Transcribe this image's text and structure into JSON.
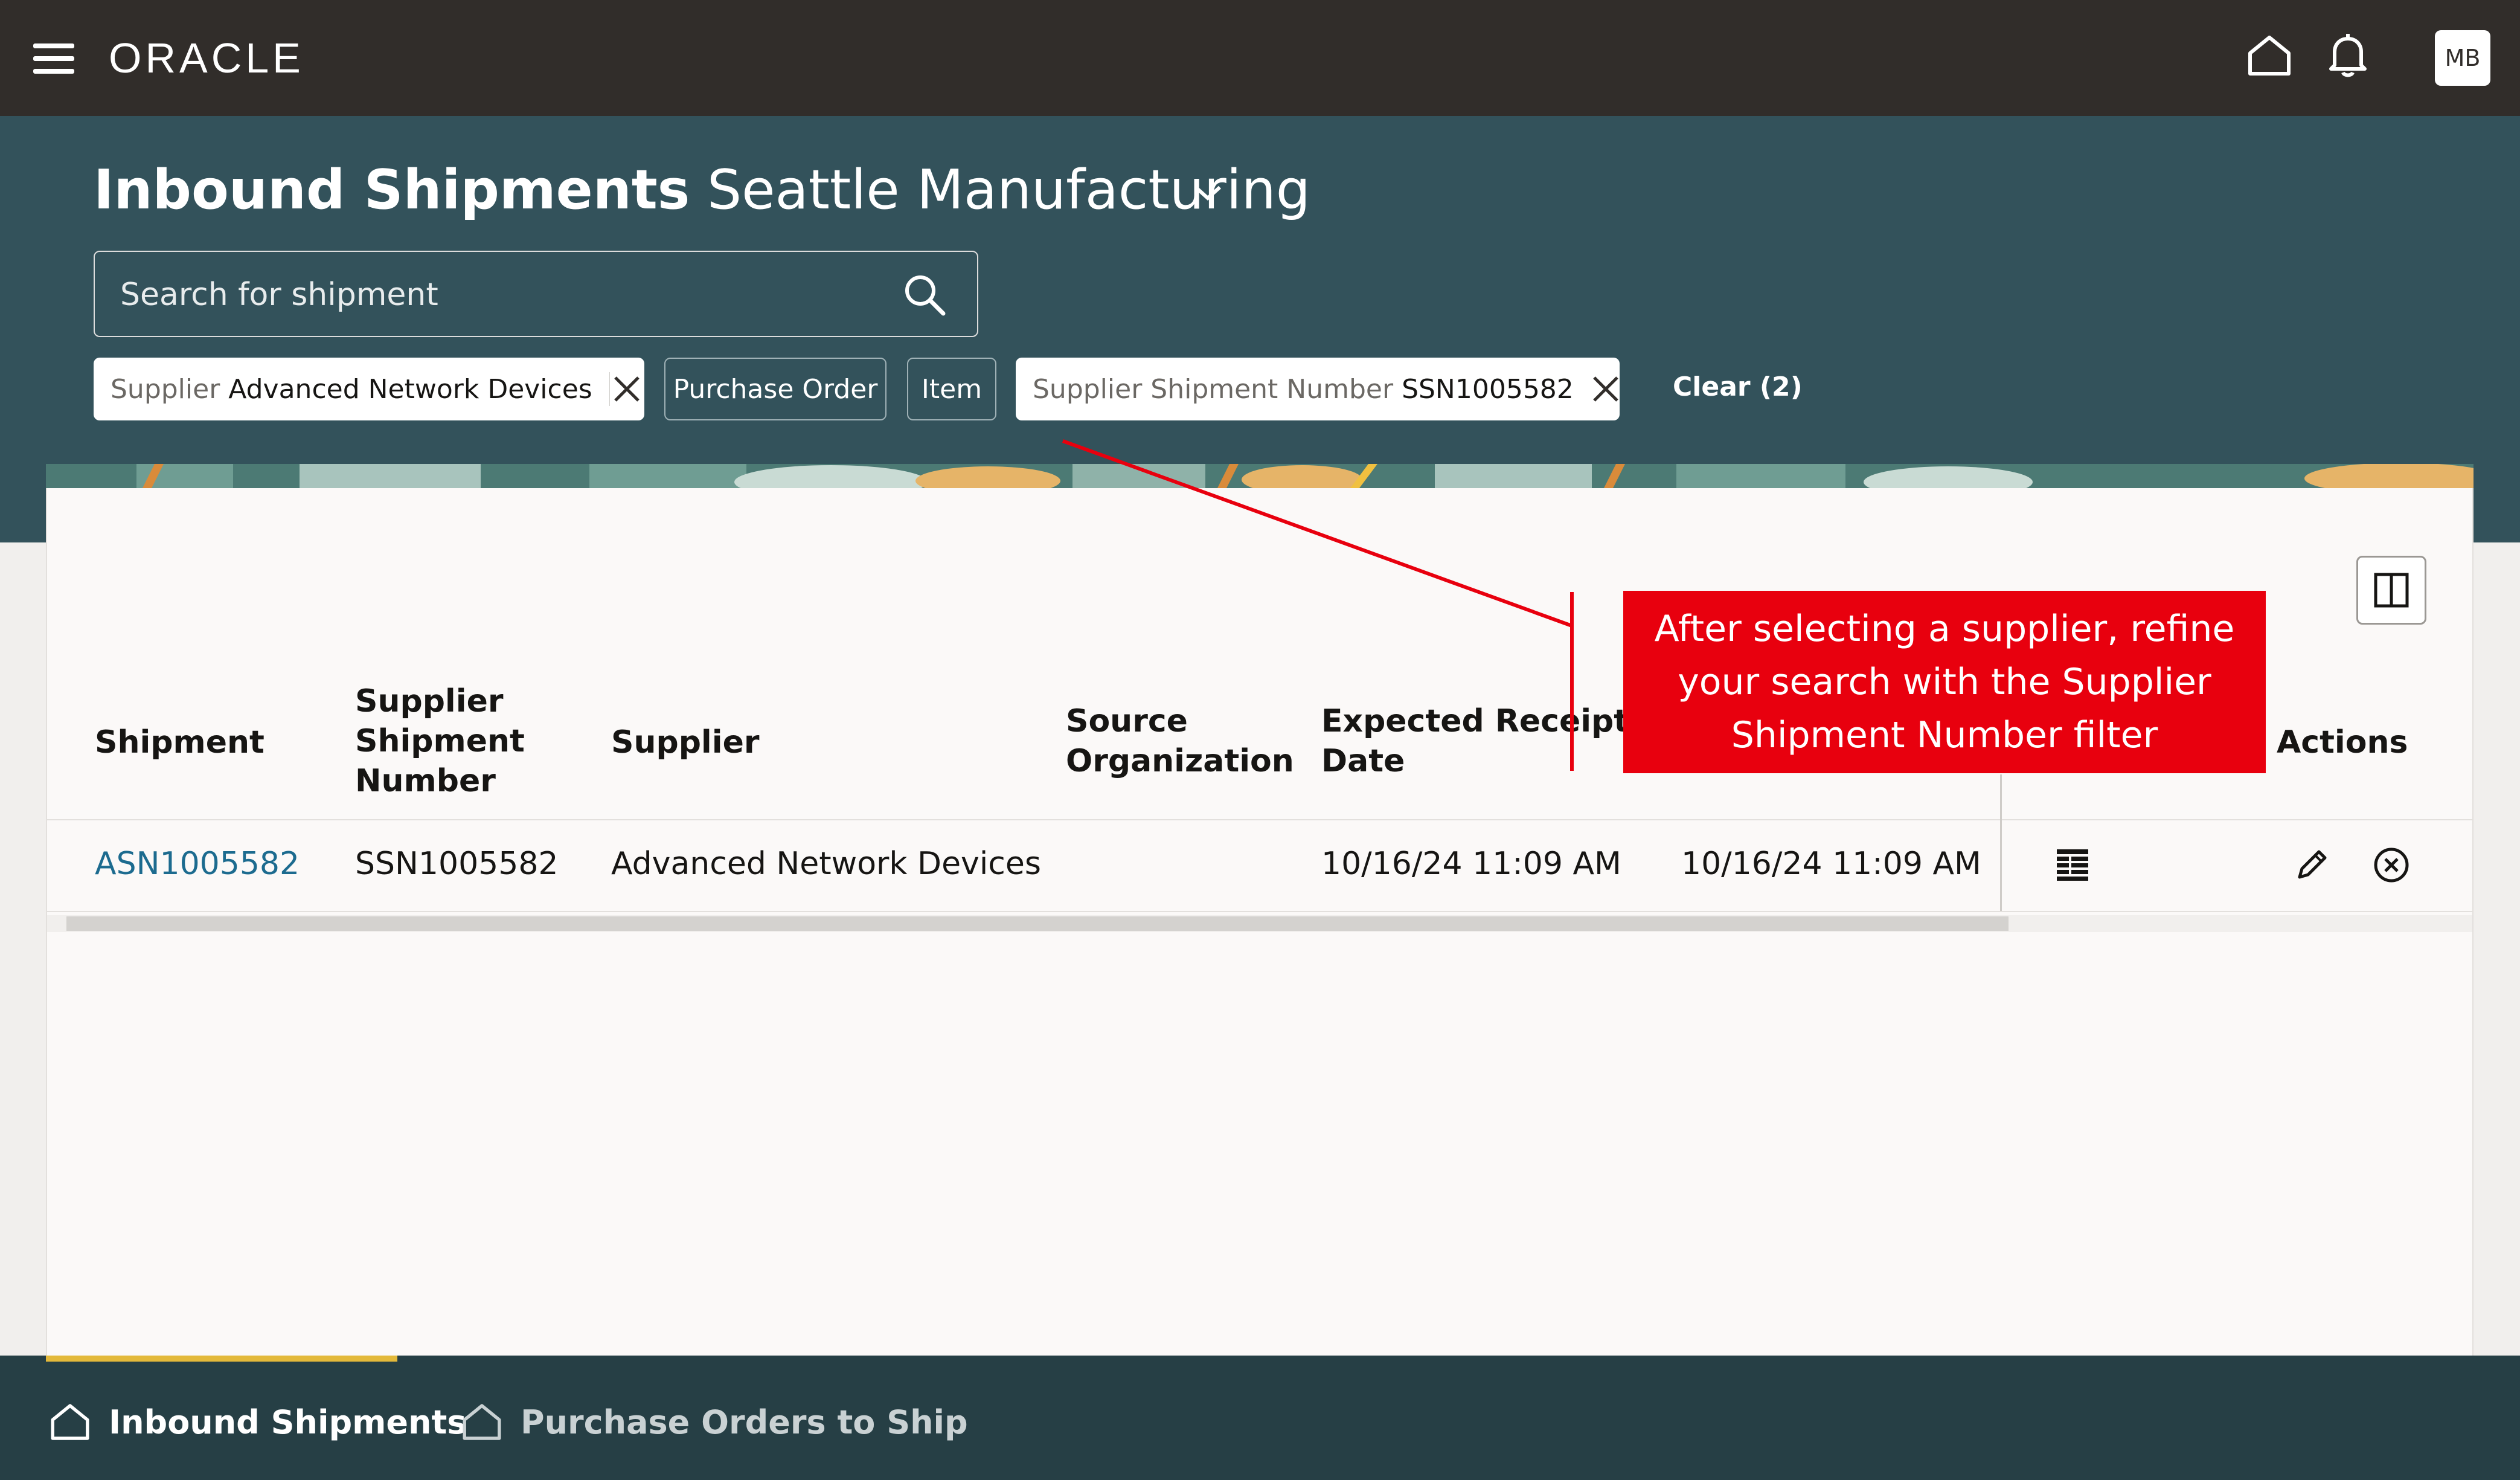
{
  "app": {
    "brand": "ORACLE",
    "user_initials": "MB"
  },
  "header": {
    "title": "Inbound Shipments",
    "organization": "Seattle Manufacturing"
  },
  "search": {
    "placeholder": "Search for shipment"
  },
  "filters": {
    "supplier": {
      "key": "Supplier",
      "value": "Advanced Network Devices"
    },
    "purchase_order": {
      "label": "Purchase Order"
    },
    "item": {
      "label": "Item"
    },
    "supplier_shipment_number": {
      "key": "Supplier Shipment Number",
      "value": "SSN1005582"
    },
    "clear": "Clear (2)"
  },
  "table": {
    "columns": {
      "shipment": "Shipment",
      "supplier_shipment_number": [
        "Supplier",
        "Shipment",
        "Number"
      ],
      "supplier": "Supplier",
      "source_organization": [
        "Source",
        "Organization"
      ],
      "expected_receipt_date": [
        "Expected Receipt",
        "Date"
      ],
      "actions": "Actions"
    },
    "rows": [
      {
        "shipment": "ASN1005582",
        "supplier_shipment_number": "SSN1005582",
        "supplier": "Advanced Network Devices",
        "source_organization": "",
        "expected_receipt_date": "10/16/24 11:09 AM",
        "shipped_date": "10/16/24 11:09 AM"
      }
    ]
  },
  "callout": {
    "text": "After selecting a supplier, refine your search with the Supplier Shipment Number filter",
    "color": "#e8000e"
  },
  "bottom_nav": {
    "items": [
      {
        "label": "Inbound Shipments",
        "active": true
      },
      {
        "label": "Purchase Orders to Ship",
        "active": false
      }
    ]
  },
  "colors": {
    "topbar": "#312d2a",
    "header_band": "#33525b",
    "link": "#1c6b8f",
    "bottom_nav": "#263f45",
    "nav_active_underline": "#e3b93a"
  }
}
